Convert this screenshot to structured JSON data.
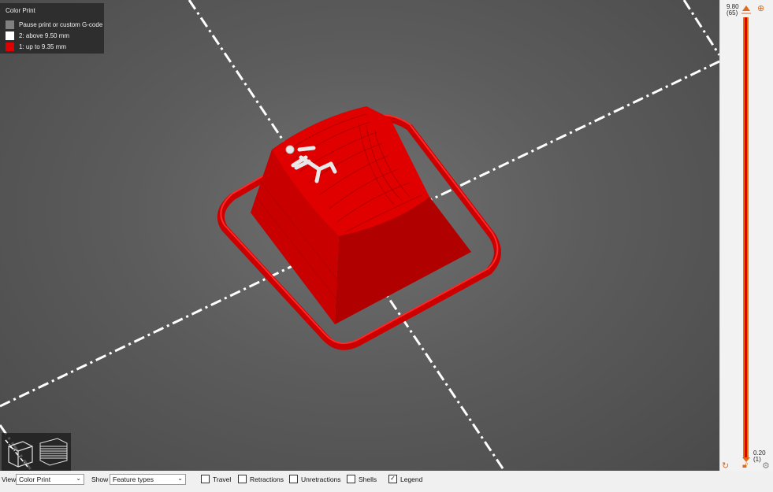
{
  "legend": {
    "title": "Color Print",
    "items": [
      {
        "label": "Pause print or custom G-code",
        "color": "#808080"
      },
      {
        "label": "2: above 9.50 mm",
        "color": "#ffffff"
      },
      {
        "label": "1: up to 9.35 mm",
        "color": "#e00000"
      }
    ]
  },
  "slider": {
    "top_value": "9.80",
    "top_layer": "(65)",
    "bottom_value": "0.20",
    "bottom_layer": "(1)",
    "accent": "#e06a1a",
    "track_color": "#e00000"
  },
  "toolbar": {
    "view_label": "View",
    "view_value": "Color Print",
    "show_label": "Show",
    "show_value": "Feature types",
    "checkboxes": [
      {
        "label": "Travel",
        "checked": false
      },
      {
        "label": "Retractions",
        "checked": false
      },
      {
        "label": "Unretractions",
        "checked": false
      },
      {
        "label": "Shells",
        "checked": false
      },
      {
        "label": "Legend",
        "checked": true
      }
    ]
  },
  "colors": {
    "model_red": "#d40000",
    "model_dark": "#9a0000",
    "figure_white": "#e8e8e8",
    "bed_gray": "#5e5e5e"
  },
  "icons": [
    "iso-view-cube-icon",
    "layers-view-icon",
    "plus-icon",
    "reset-icon",
    "lock-icon",
    "settings-gear-icon"
  ]
}
